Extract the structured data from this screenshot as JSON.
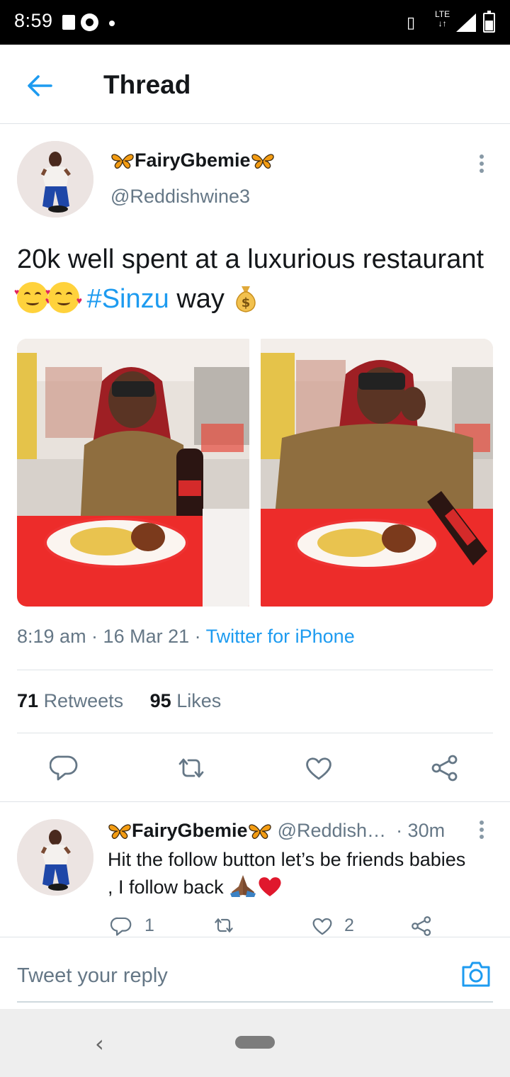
{
  "status_bar": {
    "time": "8:59",
    "network": "LTE"
  },
  "header": {
    "title": "Thread"
  },
  "tweet": {
    "author_name": "FairyGbemie",
    "author_handle": "@Reddishwine3",
    "text_before_tag": "20k well spent at a luxurious restaurant",
    "hashtag": "#Sinzu",
    "text_after_tag": "way",
    "emojis": [
      "smiling-face-with-hearts-icon",
      "smiling-face-with-hearts-icon",
      "money-bag-icon"
    ],
    "timestamp": "8:19 am · 16 Mar 21 · ",
    "source": "Twitter for iPhone",
    "retweets_count": "71",
    "retweets_label": "Retweets",
    "likes_count": "95",
    "likes_label": "Likes"
  },
  "reply": {
    "author_name": "FairyGbemie",
    "handle_truncated": "@Reddish…",
    "time": "· 30m",
    "text": "Hit the follow button let’s be friends babies , I follow back",
    "reply_count": "1",
    "retweet_count": "",
    "like_count": "2"
  },
  "composer": {
    "placeholder": "Tweet your reply"
  },
  "colors": {
    "accent": "#1d9bf0",
    "secondary_text": "#657786",
    "divider": "#dfe3e7"
  }
}
